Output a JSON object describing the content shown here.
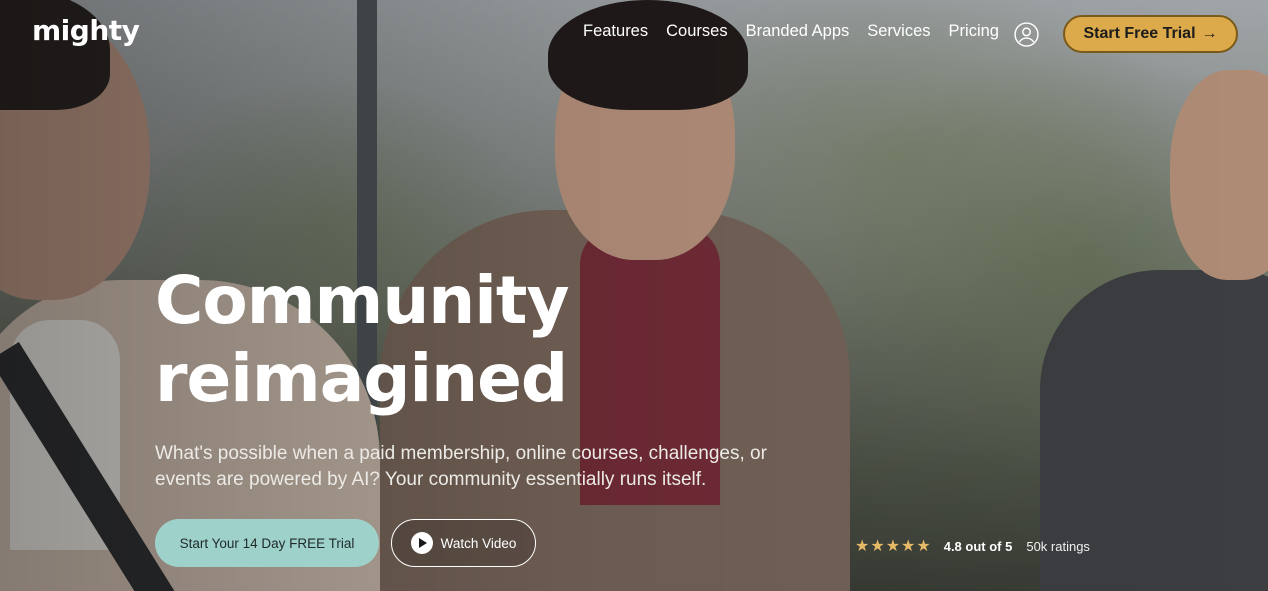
{
  "header": {
    "logo_text": "mighty",
    "nav_items": [
      "Features",
      "Courses",
      "Branded Apps",
      "Services",
      "Pricing"
    ],
    "cta_label": "Start Free Trial",
    "cta_arrow": "→",
    "cta_color": "#dcaa4b"
  },
  "hero": {
    "headline_line1": "Community",
    "headline_line2": "reimagined",
    "subtext_line1": "What's possible when a paid membership, online courses, challenges, or",
    "subtext_line2": "events are powered by AI? Your community essentially runs itself.",
    "primary_button": "Start Your 14 Day FREE Trial",
    "primary_button_color": "#9fd1cb",
    "video_button": "Watch Video"
  },
  "rating": {
    "stars": "★★★★★",
    "score_text": "4.8 out of 5",
    "count_text": "50k ratings",
    "star_color": "#e6b967"
  }
}
